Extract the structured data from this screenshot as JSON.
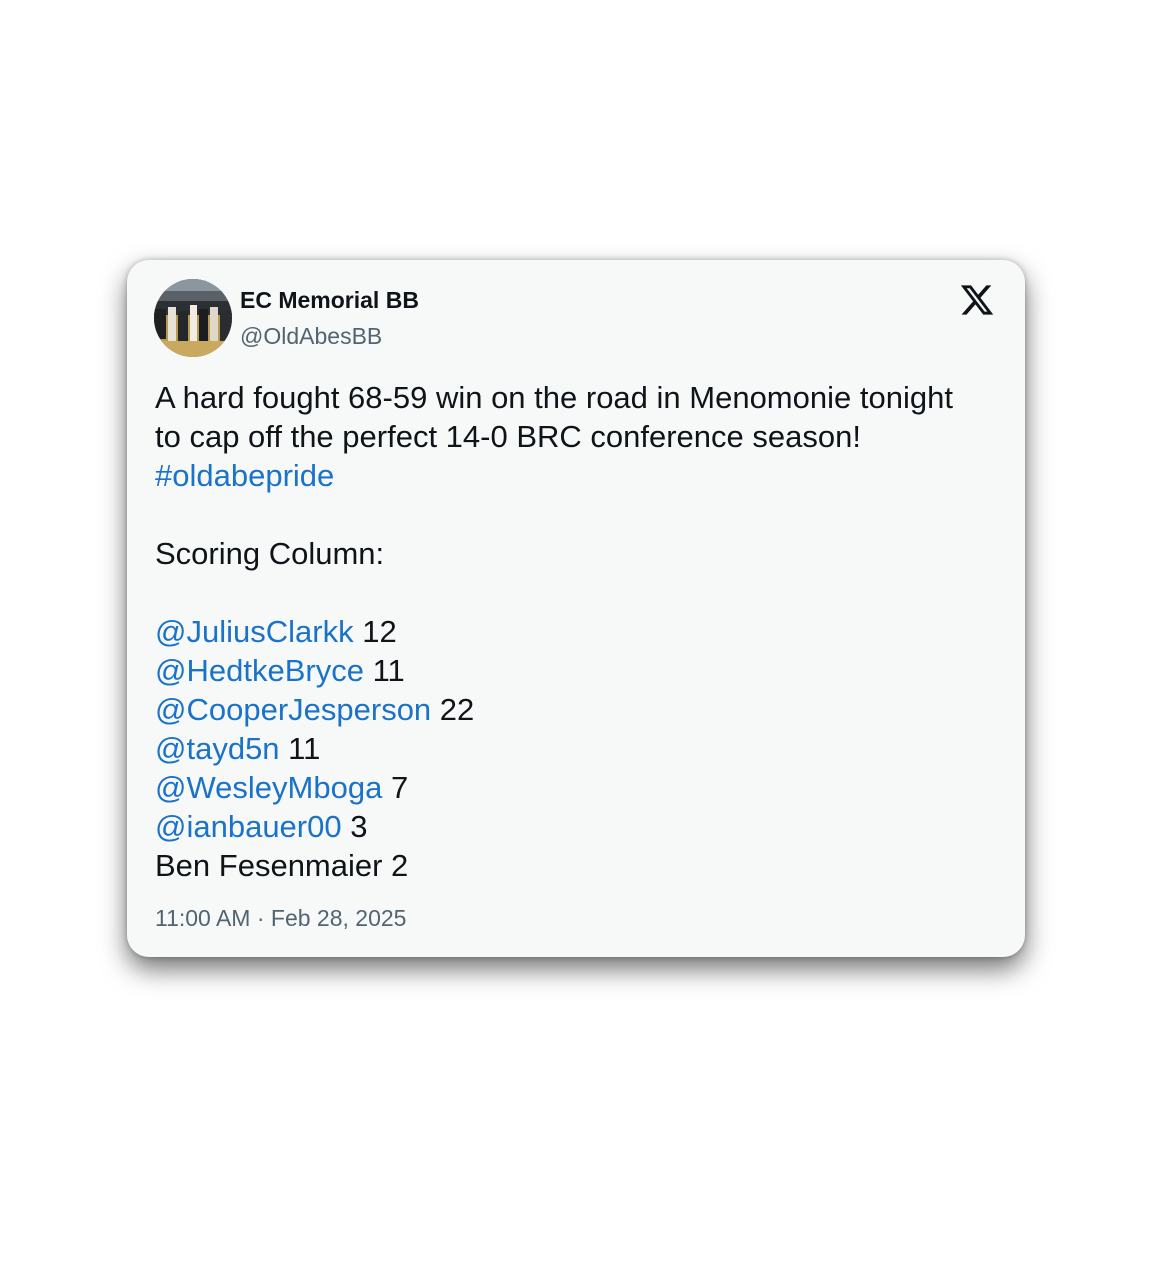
{
  "author": {
    "name": "EC Memorial BB",
    "handle": "@OldAbesBB"
  },
  "platform_icon": "x-logo-icon",
  "tweet": {
    "line1": "A hard fought 68-59 win on the road in Menomonie tonight",
    "line2": "to cap off the perfect 14-0 BRC conference season!",
    "hashtag": "#oldabepride",
    "section_heading": "Scoring Column:",
    "scorers": [
      {
        "mention": "@JuliusClarkk",
        "points": "12"
      },
      {
        "mention": "@HedtkeBryce",
        "points": "11"
      },
      {
        "mention": "@CooperJesperson",
        "points": "22"
      },
      {
        "mention": "@tayd5n",
        "points": "11"
      },
      {
        "mention": "@WesleyMboga",
        "points": "7"
      },
      {
        "mention": "@ianbauer00",
        "points": "3"
      }
    ],
    "last_scorer": "Ben Fesenmaier 2"
  },
  "timestamp": "11:00 AM · Feb 28, 2025",
  "colors": {
    "link": "#1a73c8",
    "text": "#0f1419",
    "muted": "#536471",
    "card_bg": "#f7f9f9"
  }
}
